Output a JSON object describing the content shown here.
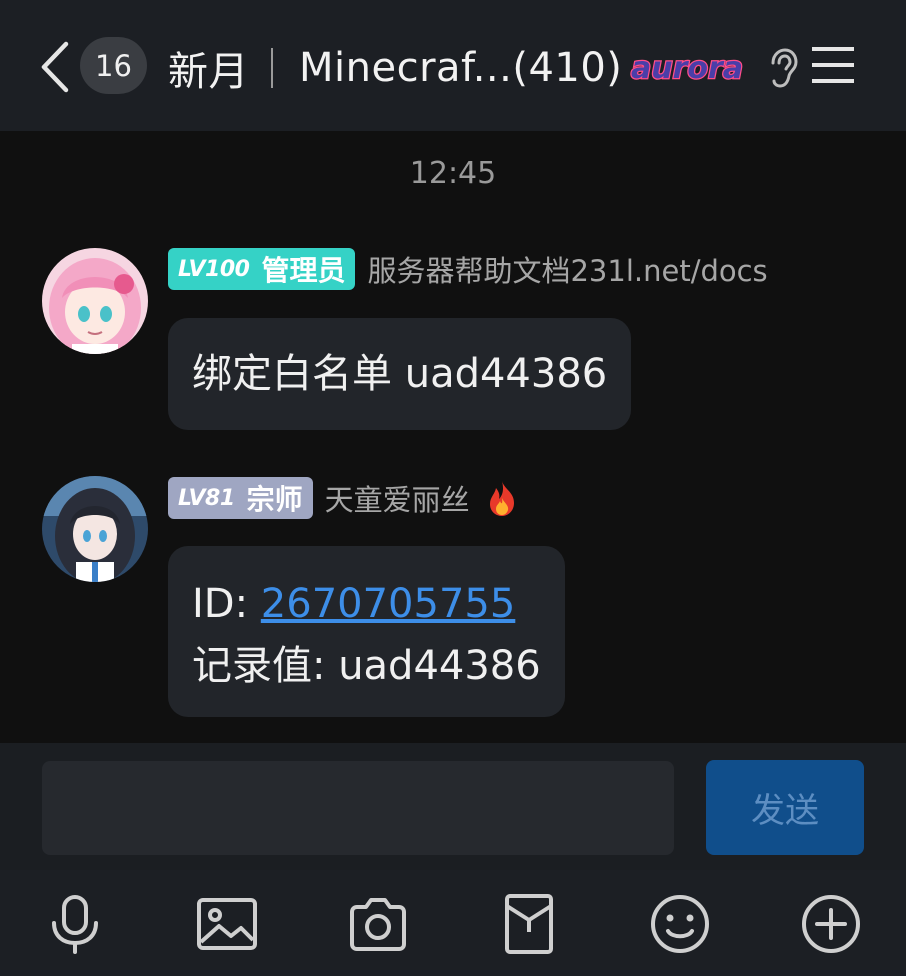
{
  "header": {
    "unread_count": "16",
    "group_name": "新月",
    "chat_name": "Minecraf...(410)",
    "logo_text": "aurora",
    "icons": [
      "back-chevron-icon",
      "ear-icon",
      "menu-icon"
    ]
  },
  "timestamp": "12:45",
  "messages": [
    {
      "level": "LV100",
      "role": "管理员",
      "sender": "服务器帮助文档231l.net/docs",
      "avatar": "pink-haired-anime-girl-avatar",
      "lines": [
        "绑定白名单 uad44386"
      ]
    },
    {
      "level": "LV81",
      "role": "宗师",
      "sender": "天童爱丽丝",
      "avatar": "dark-haired-anime-girl-avatar",
      "id_label": "ID: ",
      "id_value": "2670705755",
      "record_line": "记录值: uad44386"
    }
  ],
  "input": {
    "value": "",
    "placeholder": "",
    "send_label": "发送"
  },
  "toolbar": {
    "items": [
      "microphone-icon",
      "image-icon",
      "camera-icon",
      "red-packet-icon",
      "emoji-icon",
      "plus-icon"
    ]
  },
  "colors": {
    "background": "#101010",
    "header": "#1c1f24",
    "bubble": "#22252a",
    "admin_badge": "#35d2c6",
    "master_badge": "#9fa6c2",
    "link": "#3d8ee8",
    "send_button": "#104e8b"
  }
}
